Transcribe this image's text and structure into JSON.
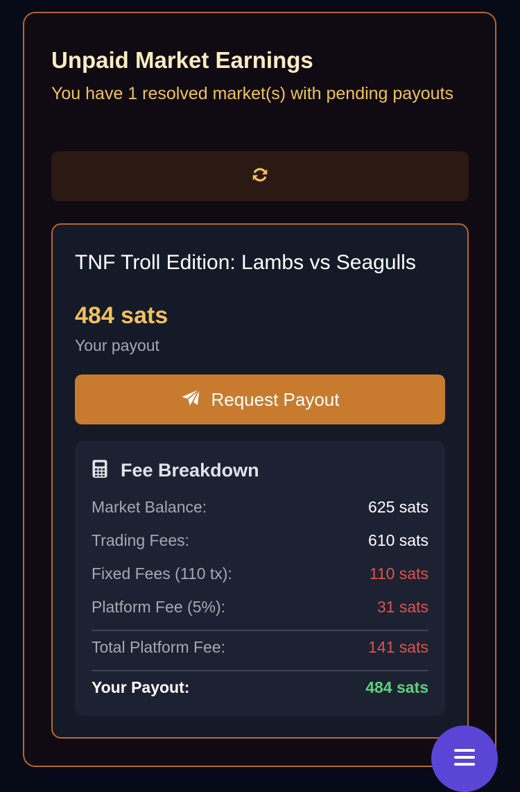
{
  "earnings": {
    "title": "Unpaid Market Earnings",
    "subtitle": "You have 1 resolved market(s) with pending payouts",
    "refresh_icon": "refresh-icon"
  },
  "market": {
    "title": "TNF Troll Edition: Lambs vs Seagulls",
    "payout_amount": "484 sats",
    "payout_label": "Your payout",
    "request_button_label": "Request Payout",
    "request_icon": "paper-plane-icon"
  },
  "fee_breakdown": {
    "heading": "Fee Breakdown",
    "icon": "calculator-icon",
    "rows": [
      {
        "label": "Market Balance:",
        "value": "625 sats"
      },
      {
        "label": "Trading Fees:",
        "value": "610 sats"
      },
      {
        "label": "Fixed Fees (110 tx):",
        "value": "110 sats"
      },
      {
        "label": "Platform Fee (5%):",
        "value": "31 sats"
      }
    ],
    "total": {
      "label": "Total Platform Fee:",
      "value": "141 sats"
    },
    "your_payout": {
      "label": "Your Payout:",
      "value": "484 sats"
    }
  },
  "fab": {
    "icon": "menu-icon"
  },
  "colors": {
    "accent_orange": "#c87b2e",
    "border_orange": "#b8672b",
    "gold": "#f1c15c",
    "negative_red": "#e0514f",
    "positive_green": "#5fcf7c",
    "fab_purple": "#5b45d6"
  }
}
